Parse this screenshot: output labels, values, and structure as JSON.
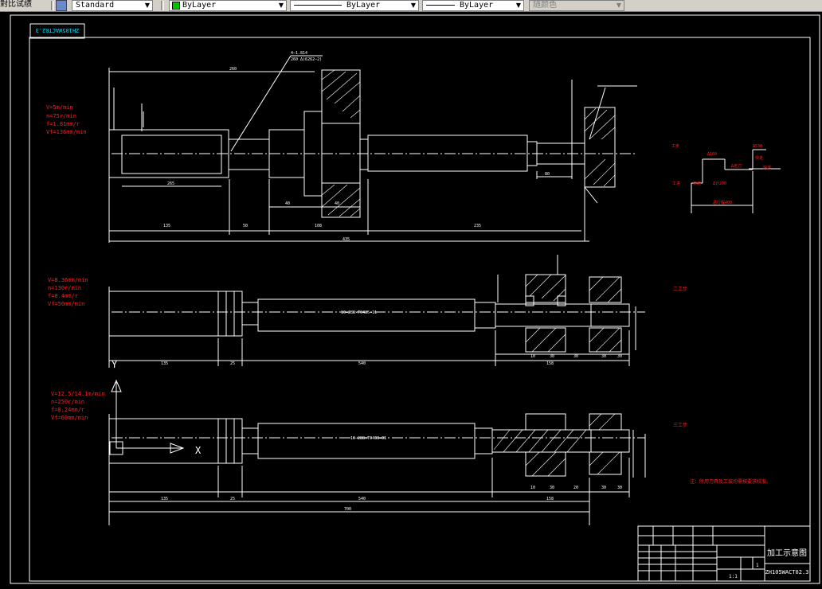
{
  "toolbar": {
    "workspace_label": "對比试绩",
    "textstyle_value": "Standard",
    "layer_value": "ByLayer",
    "linetype_value": "ByLayer",
    "lineweight_value": "ByLayer",
    "plotstyle_value": "随颜色",
    "colors": {
      "layer_swatch": "#00c000"
    }
  },
  "drawing": {
    "stamp_mirrored": "ZH105WACT02.3",
    "section1": {
      "params": [
        "V=5m/min",
        "n=75r/min",
        "f=1.81mm/r",
        "Vf=136mm/min"
      ],
      "dims": {
        "top": "260",
        "d1": "135",
        "d2": "50",
        "d3": "108",
        "d4": "235",
        "total": "435",
        "inner": "265",
        "label_a": "40",
        "label_b": "40",
        "right": "80",
        "note1": "4—1.814",
        "note2": "260  Δ(6262—2)"
      },
      "note_red": [
        "工步",
        "Δ160",
        "Δ530",
        "Δ走刀",
        "快走",
        "工进",
        "快进",
        "Δ计200",
        "快退",
        "总行程400"
      ]
    },
    "section2": {
      "params": [
        "V=8.36mm/min",
        "n=130r/min",
        "f=0.4mm/r",
        "Vf=50mm/min"
      ],
      "dims": {
        "d1": "135",
        "d2": "25",
        "d3": "540",
        "d4": "158",
        "spline": "10—288×T0425—11",
        "s1": "10",
        "s2": "30",
        "s3": "30",
        "s4": "30",
        "s5": "30"
      },
      "label_red": "二工步"
    },
    "section3": {
      "params": [
        "V=12.5/14.1m/min",
        "n=250r/min",
        "f=0.24mm/r",
        "Vf=60mm/min"
      ],
      "dims": {
        "d1": "135",
        "d2": "25",
        "d3": "540",
        "d4": "158",
        "total": "700",
        "spline": "10—288×T0433—01",
        "s1": "10",
        "s2": "30",
        "s3": "20",
        "s4": "30",
        "s5": "30"
      },
      "label_red": "三工步",
      "note_red": "注：所用刀具及工装均需按要求校准。"
    },
    "axes": {
      "y": "Y",
      "x": "X"
    },
    "title_block": {
      "title": "加工示意图",
      "code": "ZH105WACT02.3",
      "scale": "1:1",
      "sheet": "1"
    },
    "colors": {
      "line": "#ffffff",
      "dim": "#ffffff",
      "red": "#ff2020",
      "cyan": "#00e0ff",
      "bg": "#000000"
    }
  }
}
